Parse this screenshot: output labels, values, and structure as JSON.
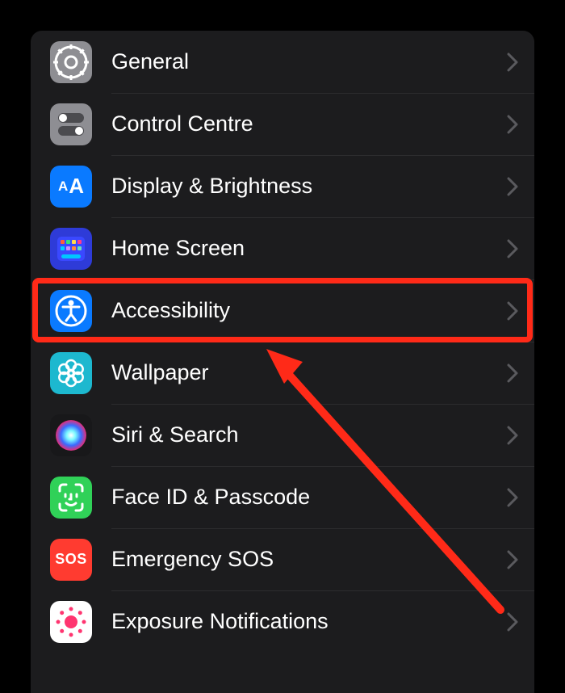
{
  "settings": {
    "items": [
      {
        "id": "general",
        "label": "General"
      },
      {
        "id": "control-centre",
        "label": "Control Centre"
      },
      {
        "id": "display-brightness",
        "label": "Display & Brightness"
      },
      {
        "id": "home-screen",
        "label": "Home Screen"
      },
      {
        "id": "accessibility",
        "label": "Accessibility"
      },
      {
        "id": "wallpaper",
        "label": "Wallpaper"
      },
      {
        "id": "siri-search",
        "label": "Siri & Search"
      },
      {
        "id": "face-id-passcode",
        "label": "Face ID & Passcode"
      },
      {
        "id": "emergency-sos",
        "label": "Emergency SOS"
      },
      {
        "id": "exposure-notifications",
        "label": "Exposure Notifications"
      }
    ]
  },
  "annotation": {
    "highlighted_item_id": "accessibility"
  }
}
